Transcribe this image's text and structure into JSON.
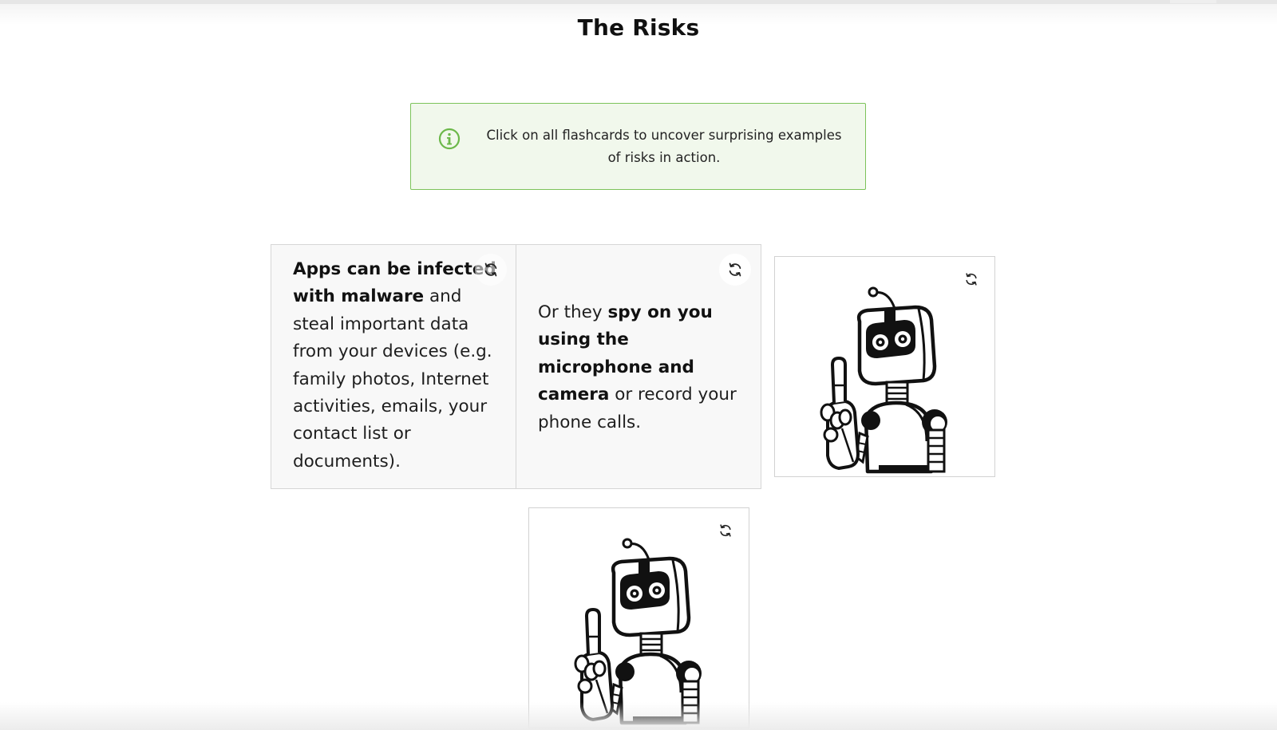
{
  "page": {
    "title": "The Risks"
  },
  "info_box": {
    "icon": "info-circle-icon",
    "text": "Click on all flashcards to uncover surprising examples of risks in action.",
    "accent_color": "#7cc35a",
    "background_color": "#f1f8ec"
  },
  "flashcards": [
    {
      "bold_1": "Apps can be infected with malware",
      "text_1": " and steal important data from your devices (e.g. family photos, Internet activities, emails, your contact list or documents).",
      "flip_icon": "refresh-icon"
    },
    {
      "text_1": "Or they ",
      "bold_1": "spy on you using the microphone and camera",
      "text_2": " or record your phone calls.",
      "flip_icon": "refresh-icon"
    },
    {
      "image": "robot-pointing-illustration",
      "flip_icon": "refresh-icon"
    },
    {
      "image": "robot-pointing-illustration",
      "flip_icon": "refresh-icon"
    }
  ]
}
